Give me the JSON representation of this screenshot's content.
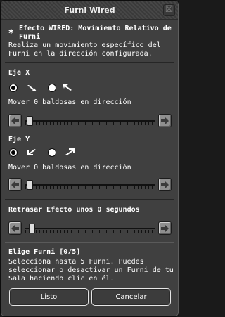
{
  "window": {
    "title": "Furni Wired",
    "close_glyph": "☒"
  },
  "header": {
    "icon": "wired-star-icon",
    "title": "Efecto WIRED: Movimiento Relativo de Furni",
    "description": "Realiza un movimiento específico del Furni en la dirección configurada."
  },
  "axis_x": {
    "label": "Eje X",
    "options": [
      {
        "direction": "down-right",
        "selected": true
      },
      {
        "direction": "up-left",
        "selected": false
      }
    ],
    "move_text": "Mover 0 baldosas en dirección",
    "slider_value": 0
  },
  "axis_y": {
    "label": "Eje Y",
    "options": [
      {
        "direction": "down-left",
        "selected": true
      },
      {
        "direction": "up-right",
        "selected": false
      }
    ],
    "move_text": "Mover 0 baldosas en dirección",
    "slider_value": 0
  },
  "delay": {
    "label": "Retrasar Efecto unos 0 segundos",
    "slider_value": 0
  },
  "furni": {
    "label": "Elige Furni [0/5]",
    "description": "Selecciona hasta 5 Furni. Puedes seleccionar o desactivar un Furni de tu Sala haciendo clic en él."
  },
  "buttons": {
    "ok": "Listo",
    "cancel": "Cancelar"
  },
  "colors": {
    "window_bg": "#404040",
    "button_face": "#8f8f8f",
    "text": "#ffffff"
  }
}
